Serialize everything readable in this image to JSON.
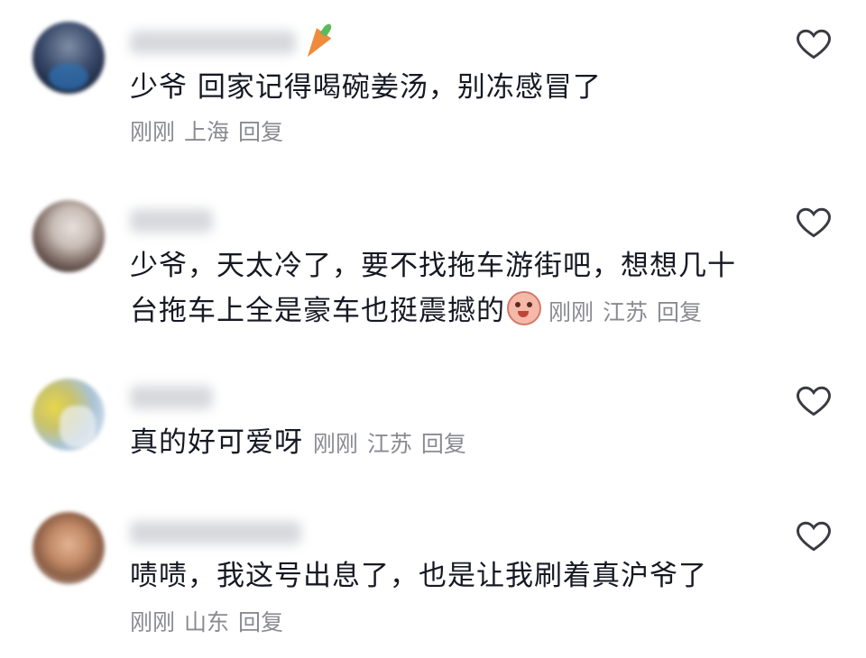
{
  "comments": [
    {
      "text": "少爷 回家记得喝碗姜汤，别冻感冒了",
      "time": "刚刚",
      "location": "上海",
      "reply_label": "回复"
    },
    {
      "text_line1": "少爷，天太冷了，要不找拖车游街吧，想想几十",
      "text_line2": "台拖车上全是豪车也挺震撼的",
      "time": "刚刚",
      "location": "江苏",
      "reply_label": "回复"
    },
    {
      "text": "真的好可爱呀",
      "time": "刚刚",
      "location": "江苏",
      "reply_label": "回复"
    },
    {
      "text": "啧啧，我这号出息了，也是让我刷着真沪爷了",
      "time": "刚刚",
      "location": "山东",
      "reply_label": "回复"
    }
  ],
  "icons": {
    "like": "heart-outline-icon",
    "badge": "carrot-icon",
    "emoji": "grinning-face-emoji"
  },
  "colors": {
    "text": "#161823",
    "meta": "#8a8b91",
    "background": "#ffffff"
  }
}
